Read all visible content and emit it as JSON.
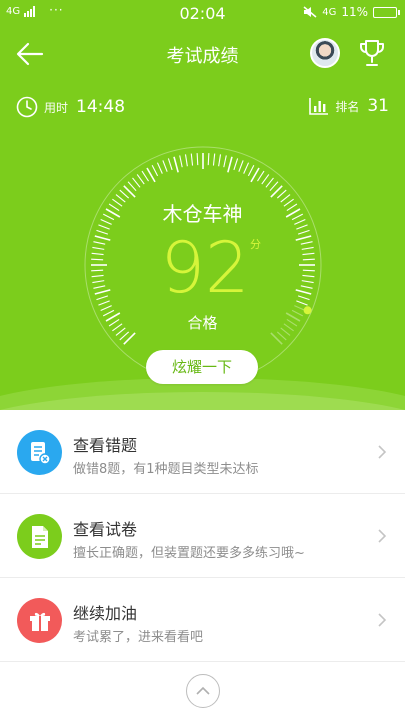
{
  "status_bar": {
    "network": "4G",
    "time": "02:04",
    "network_right": "4G",
    "battery": "11%"
  },
  "header": {
    "title": "考试成绩",
    "back_icon": "arrow-left-icon",
    "trophy_icon": "trophy-icon"
  },
  "stats": {
    "time_label": "用时",
    "time_value": "14:48",
    "rank_label": "排名",
    "rank_value": "31"
  },
  "result": {
    "name": "木仓车神",
    "score": "92",
    "score_unit": "分",
    "score_fraction": 0.92,
    "verdict": "合格",
    "share_label": "炫耀一下"
  },
  "menu": [
    {
      "title": "查看错题",
      "subtitle": "做错8题，有1种题目类型未达标",
      "icon": "wrong-questions-icon",
      "color": "#2aa8ef"
    },
    {
      "title": "查看试卷",
      "subtitle": "擅长正确题，但装置题还要多多练习哦~",
      "icon": "paper-icon",
      "color": "#7ccd1c"
    },
    {
      "title": "继续加油",
      "subtitle": "考试累了，进来看看吧",
      "icon": "gift-icon",
      "color": "#f25a5a"
    }
  ],
  "colors": {
    "hero": "#7ccd1c",
    "score": "#d6f53a",
    "accent_blue": "#2aa8ef",
    "accent_red": "#f25a5a"
  }
}
